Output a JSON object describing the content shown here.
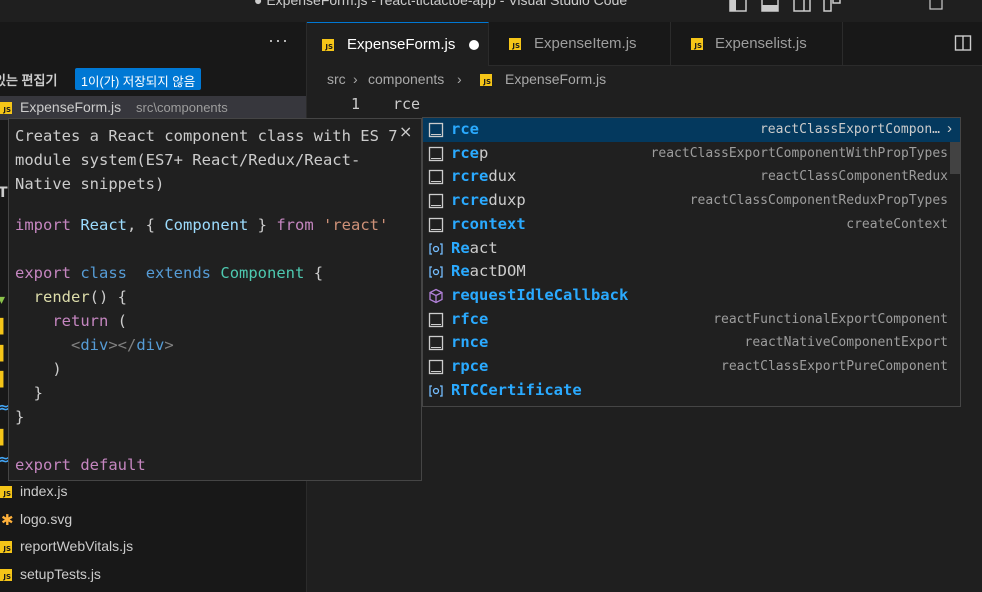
{
  "window": {
    "title": "● ExpenseForm.js - react-tictactoe-app - Visual Studio Code"
  },
  "sidebar": {
    "title": "ı",
    "open_editors": {
      "title": "있는 편집기",
      "unsaved_badge": "1이(가) 저장되지 않음",
      "files": [
        {
          "name": "ExpenseForm.js",
          "path": "src\\components"
        }
      ]
    },
    "files": [
      "index.js",
      "logo.svg",
      "reportWebVitals.js",
      "setupTests.js"
    ]
  },
  "tabs": [
    {
      "label": "ExpenseForm.js",
      "active": true,
      "dirty": true
    },
    {
      "label": "ExpenseItem.js",
      "active": false
    },
    {
      "label": "Expenselist.js",
      "active": false
    }
  ],
  "breadcrumb": {
    "parts": [
      "src",
      "components",
      "ExpenseForm.js"
    ]
  },
  "editor": {
    "line_number": "1",
    "code": "rce"
  },
  "doc_popup": {
    "description": "Creates a React component class with ES 7 module system(ES7+ React/Redux/React-Native snippets)",
    "close": "×"
  },
  "suggestions": [
    {
      "match": "rce",
      "rest": "",
      "detail": "reactClassExportCompon…",
      "kind": "snippet",
      "focused": true
    },
    {
      "match": "rce",
      "rest": "p",
      "detail": "reactClassExportComponentWithPropTypes",
      "kind": "snippet"
    },
    {
      "match": "rcre",
      "rest": "dux",
      "detail": "reactClassComponentRedux",
      "kind": "snippet"
    },
    {
      "match": "rcre",
      "rest": "duxp",
      "detail": "reactClassComponentReduxPropTypes",
      "kind": "snippet"
    },
    {
      "match": "rcontext",
      "rest": "",
      "detail": "createContext",
      "kind": "snippet"
    },
    {
      "match": "Re",
      "rest": "act",
      "detail": "",
      "kind": "reference"
    },
    {
      "match": "Re",
      "rest": "actDOM",
      "detail": "",
      "kind": "reference"
    },
    {
      "match": "requestIdleCallback",
      "rest": "",
      "detail": "",
      "kind": "module"
    },
    {
      "match": "rfce",
      "rest": "",
      "detail": "reactFunctionalExportComponent",
      "kind": "snippet"
    },
    {
      "match": "rnce",
      "rest": "",
      "detail": "reactNativeComponentExport",
      "kind": "snippet"
    },
    {
      "match": "rpce",
      "rest": "",
      "detail": "reactClassExportPureComponent",
      "kind": "snippet"
    },
    {
      "match": "RTCCertificate",
      "rest": "",
      "detail": "",
      "kind": "reference"
    }
  ],
  "colors": {
    "accent": "#0078d4",
    "match_highlight": "#2aaaff",
    "js_icon": "#f5c518"
  }
}
